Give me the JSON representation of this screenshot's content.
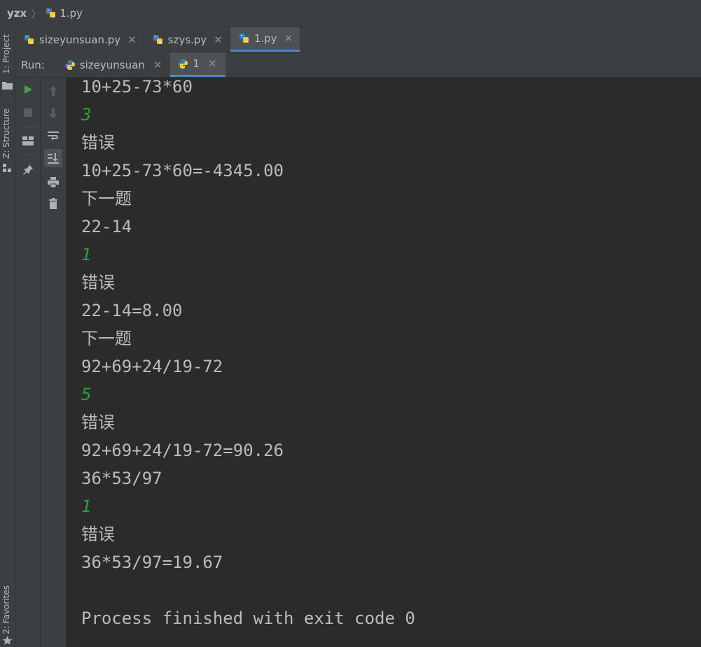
{
  "navbar": {
    "project": "yzx",
    "file": "1.py"
  },
  "left_strip": {
    "project": "1: Project",
    "structure": "Z: Structure",
    "favorites": "2: Favorites"
  },
  "editor_tabs": [
    {
      "label": "sizeyunsuan.py",
      "active": false
    },
    {
      "label": "szys.py",
      "active": false
    },
    {
      "label": "1.py",
      "active": true
    }
  ],
  "run": {
    "label": "Run:",
    "tabs": [
      {
        "label": "sizeyunsuan",
        "active": false
      },
      {
        "label": "1",
        "active": true
      }
    ]
  },
  "console": {
    "lines": [
      {
        "text": "10+25-73*60",
        "kind": "output"
      },
      {
        "text": "3",
        "kind": "input"
      },
      {
        "text": "错误",
        "kind": "output"
      },
      {
        "text": "10+25-73*60=-4345.00",
        "kind": "output"
      },
      {
        "text": "下一题",
        "kind": "output"
      },
      {
        "text": "22-14",
        "kind": "output"
      },
      {
        "text": "1",
        "kind": "input"
      },
      {
        "text": "错误",
        "kind": "output"
      },
      {
        "text": "22-14=8.00",
        "kind": "output"
      },
      {
        "text": "下一题",
        "kind": "output"
      },
      {
        "text": "92+69+24/19-72",
        "kind": "output"
      },
      {
        "text": "5",
        "kind": "input"
      },
      {
        "text": "错误",
        "kind": "output"
      },
      {
        "text": "92+69+24/19-72=90.26",
        "kind": "output"
      },
      {
        "text": "36*53/97",
        "kind": "output"
      },
      {
        "text": "1",
        "kind": "input"
      },
      {
        "text": "错误",
        "kind": "output"
      },
      {
        "text": "36*53/97=19.67",
        "kind": "output"
      },
      {
        "text": "",
        "kind": "output"
      },
      {
        "text": "Process finished with exit code 0",
        "kind": "output"
      }
    ]
  },
  "icons": {
    "python_file": "python-file-icon",
    "run": "run-icon",
    "stop": "stop-icon",
    "layout": "layout-icon",
    "pin": "pin-icon",
    "up": "arrow-up-icon",
    "down": "arrow-down-icon",
    "wrap": "soft-wrap-icon",
    "scroll_end": "scroll-to-end-icon",
    "print": "print-icon",
    "trash": "trash-icon"
  },
  "colors": {
    "background": "#2b2b2b",
    "panel": "#3c3f41",
    "text": "#bbbbbb",
    "input_text": "#2e9e3a",
    "run_green": "#499c54",
    "accent": "#4a88c7"
  }
}
